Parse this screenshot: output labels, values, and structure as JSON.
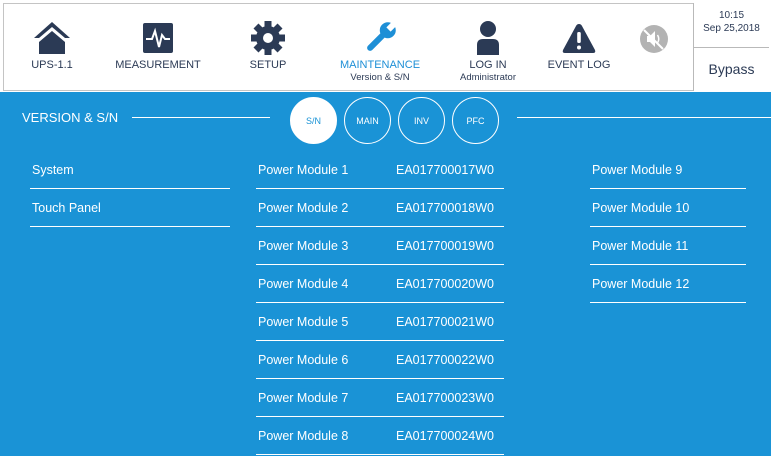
{
  "nav": {
    "ups": {
      "label": "UPS-1.1",
      "icon": "home-icon"
    },
    "measurement": {
      "label": "MEASUREMENT",
      "icon": "waveform-icon"
    },
    "setup": {
      "label": "SETUP",
      "icon": "gear-icon"
    },
    "maintenance": {
      "label": "MAINTENANCE",
      "sublabel": "Version & S/N",
      "icon": "wrench-icon"
    },
    "login": {
      "label": "LOG IN",
      "sublabel": "Administrator",
      "icon": "user-icon"
    },
    "eventlog": {
      "label": "EVENT LOG",
      "icon": "warning-icon"
    },
    "mute": {
      "icon": "speaker-muted-icon"
    }
  },
  "status": {
    "time": "10:15",
    "date": "Sep 25,2018",
    "mode": "Bypass"
  },
  "section": {
    "title": "VERSION & S/N"
  },
  "tabs": [
    "S/N",
    "MAIN",
    "INV",
    "PFC"
  ],
  "left_items": [
    "System",
    "Touch Panel"
  ],
  "modules": [
    {
      "name": "Power Module 1",
      "sn": "EA017700017W0"
    },
    {
      "name": "Power Module 2",
      "sn": "EA017700018W0"
    },
    {
      "name": "Power Module 3",
      "sn": "EA017700019W0"
    },
    {
      "name": "Power Module 4",
      "sn": "EA017700020W0"
    },
    {
      "name": "Power Module 5",
      "sn": "EA017700021W0"
    },
    {
      "name": "Power Module 6",
      "sn": "EA017700022W0"
    },
    {
      "name": "Power Module 7",
      "sn": "EA017700023W0"
    },
    {
      "name": "Power Module 8",
      "sn": "EA017700024W0"
    }
  ],
  "modules_right": [
    {
      "name": "Power Module 9",
      "sn": ""
    },
    {
      "name": "Power Module 10",
      "sn": ""
    },
    {
      "name": "Power Module 11",
      "sn": ""
    },
    {
      "name": "Power Module 12",
      "sn": ""
    }
  ],
  "colors": {
    "accent": "#1a93d6",
    "navy": "#2b3a55",
    "active_nav": "#1e8fd6",
    "mute_gray": "#b3b3b3"
  }
}
